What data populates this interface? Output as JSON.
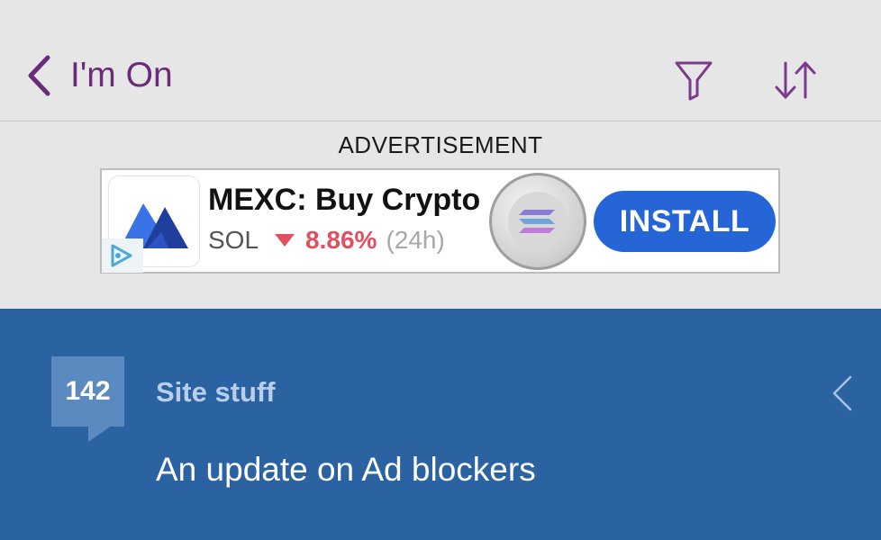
{
  "header": {
    "back_label": "I'm On",
    "icons": {
      "back": "chevron-left-icon",
      "filter": "filter-icon",
      "sort": "sort-icon"
    },
    "accent_color": "#6a2c7a"
  },
  "ad": {
    "caption": "ADVERTISEMENT",
    "title": "MEXC: Buy Crypto",
    "symbol": "SOL",
    "change": "8.86%",
    "period": "(24h)",
    "install_label": "INSTALL",
    "colors": {
      "install": "#2565d6",
      "down": "#e0505e"
    }
  },
  "thread": {
    "count": "142",
    "category": "Site stuff",
    "title": "An update on Ad blockers",
    "background": "#2a62a2"
  }
}
